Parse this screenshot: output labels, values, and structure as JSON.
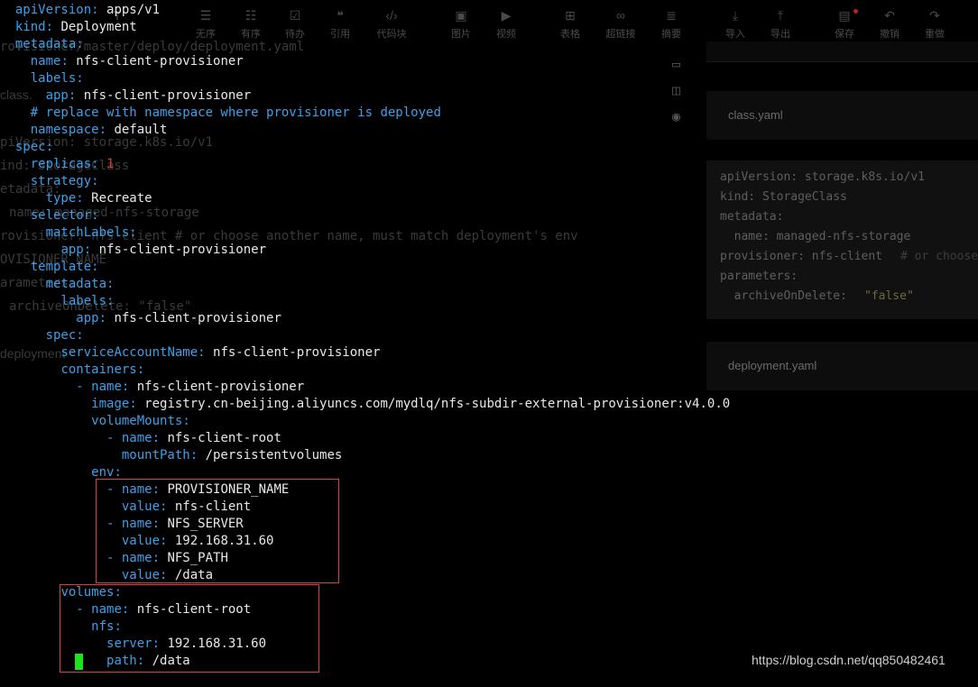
{
  "toolbar": {
    "items": [
      {
        "label": "",
        "icon": "T"
      },
      {
        "label": "无序",
        "icon": "☰"
      },
      {
        "label": "有序",
        "icon": "☷"
      },
      {
        "label": "待办",
        "icon": "☑"
      },
      {
        "label": "引用",
        "icon": "❝"
      },
      {
        "label": "代码块",
        "icon": "‹/›"
      },
      {
        "label": "图片",
        "icon": "▣"
      },
      {
        "label": "视频",
        "icon": "▶"
      },
      {
        "label": "表格",
        "icon": "⊞"
      },
      {
        "label": "超链接",
        "icon": "∞"
      },
      {
        "label": "摘要",
        "icon": "≣"
      },
      {
        "label": "导入",
        "icon": "⤓"
      },
      {
        "label": "导出",
        "icon": "⤒"
      },
      {
        "label": "保存",
        "icon": "▤"
      },
      {
        "label": "撤销",
        "icon": "↶"
      },
      {
        "label": "重做",
        "icon": "↷"
      }
    ]
  },
  "background_lines": {
    "deploy_path": "rovisioner/master/deploy/deployment.yaml",
    "class_label": "class.",
    "ghost_api": "piVersion: storage.k8s.io/v1",
    "ghost_kind": "ind: StorageClass",
    "ghost_meta": "etadata:",
    "ghost_name": "name: managed-nfs-storage",
    "ghost_prov": "rovisioner: nfs-client # or choose another name, must match deployment's env",
    "ghost_provname": "OVISIONER_NAME",
    "ghost_params": "arameters:",
    "ghost_archive": "archiveOnDelete: \"false\"",
    "ghost_deploy": "deployment"
  },
  "preview": {
    "class_file": "class.yaml",
    "deployment_file": "deployment.yaml",
    "code": [
      "apiVersion: storage.k8s.io/v1",
      "kind: StorageClass",
      "metadata:",
      "  name: managed-nfs-storage",
      "provisioner: nfs-client",
      "# or choose",
      "parameters:",
      "  archiveOnDelete:",
      "\"false\""
    ]
  },
  "code": {
    "k_apiVersion": "apiVersion",
    "v_apiVersion": "apps/v1",
    "k_kind": "kind",
    "v_kind": "Deployment",
    "k_metadata": "metadata",
    "k_name1": "name",
    "v_name1": "nfs-client-provisioner",
    "k_labels1": "labels",
    "k_app1": "app",
    "v_app1": "nfs-client-provisioner",
    "comment": "# replace with namespace where provisioner is deployed",
    "k_namespace": "namespace",
    "v_namespace": "default",
    "k_spec1": "spec",
    "k_replicas": "replicas",
    "v_replicas": "1",
    "k_strategy": "strategy",
    "k_type": "type",
    "v_type": "Recreate",
    "k_selector": "selector",
    "k_matchLabels": "matchLabels",
    "k_app2": "app",
    "v_app2": "nfs-client-provisioner",
    "k_template": "template",
    "k_metadata2": "metadata",
    "k_labels2": "labels",
    "k_app3": "app",
    "v_app3": "nfs-client-provisioner",
    "k_spec2": "spec",
    "k_sa": "serviceAccountName",
    "v_sa": "nfs-client-provisioner",
    "k_containers": "containers",
    "k_name2": "name",
    "v_name2": "nfs-client-provisioner",
    "k_image": "image",
    "v_image": "registry.cn-beijing.aliyuncs.com/mydlq/nfs-subdir-external-provisioner:v4.0.0",
    "k_volumeMounts": "volumeMounts",
    "k_name3": "name",
    "v_name3": "nfs-client-root",
    "k_mountPath": "mountPath",
    "v_mountPath": "/persistentvolumes",
    "k_env": "env",
    "k_name4": "name",
    "v_name4": "PROVISIONER_NAME",
    "k_value1": "value",
    "v_value1": "nfs-client",
    "k_name5": "name",
    "v_name5": "NFS_SERVER",
    "k_value2": "value",
    "v_value2": "192.168.31.60",
    "k_name6": "name",
    "v_name6": "NFS_PATH",
    "k_value3": "value",
    "v_value3": "/data",
    "k_volumes": "volumes",
    "k_name7": "name",
    "v_name7": "nfs-client-root",
    "k_nfs": "nfs",
    "k_server": "server",
    "v_server": "192.168.31.60",
    "k_path": "path",
    "v_path": "/data"
  },
  "watermark": "https://blog.csdn.net/qq850482461",
  "colors": {
    "key": "#3ca0ea",
    "value": "#e8e8e8",
    "number": "#e0392b",
    "highlight_box": "#d94040",
    "cursor": "#19e619"
  }
}
